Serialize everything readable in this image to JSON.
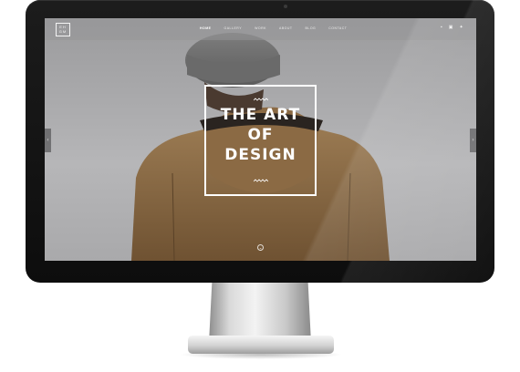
{
  "header": {
    "logo": [
      "E",
      "H",
      "G",
      "M"
    ],
    "nav_items": [
      "HOME",
      "GALLERY",
      "WORK",
      "ABOUT",
      "BLOG",
      "CONTACT"
    ],
    "social_icons": [
      "vimeo-icon",
      "instagram-icon",
      "twitter-icon"
    ]
  },
  "hero": {
    "title_lines": [
      "THE ART",
      "OF",
      "DESIGN"
    ],
    "prev_arrow": "‹",
    "next_arrow": "›",
    "scroll_glyph": "⌄"
  },
  "colors": {
    "screen_bg": "#a8a8aa",
    "bezel": "#111111",
    "text": "#ffffff",
    "jacket": "#8a6a45"
  }
}
